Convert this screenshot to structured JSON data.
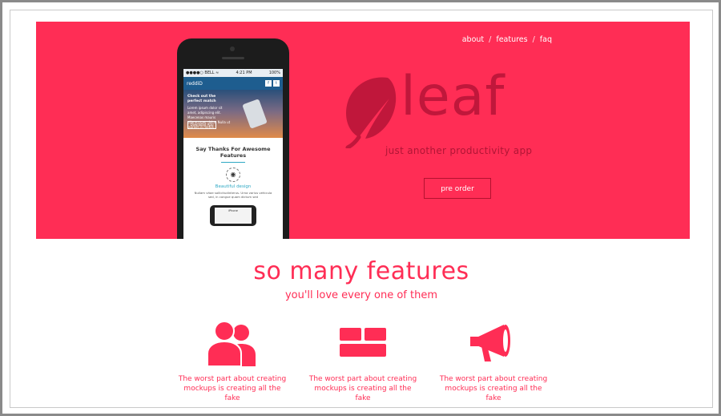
{
  "nav": {
    "items": [
      "about",
      "features",
      "faq"
    ],
    "separator": "/"
  },
  "hero": {
    "brand": "leaf",
    "tagline": "just another productivity app",
    "cta_label": "pre order",
    "background_color": "#ff2d55"
  },
  "phone_screen": {
    "status_carrier": "●●●●○ BELL ≈",
    "status_time": "4:21 PM",
    "status_battery": "100%",
    "app_name": "reddiD",
    "social": [
      "f",
      "t"
    ],
    "banner_title": "Check out the perfect match",
    "banner_body": "Lorem ipsum dolor sit amet, adipiscing elit. Maecenas mauris ullamcorper dolor. Nulla ut laoreet in metus.",
    "banner_button": "Download App",
    "section_heading": "Say Thanks For Awesome Features",
    "feature_title": "Beautiful design",
    "feature_desc": "Nullam vitae sollicitudinterus. Urna varius vehicula sed, in congue quam dictum sed",
    "mini_label": "iPhone"
  },
  "features_section": {
    "title": "so many features",
    "subtitle": "you'll love every one of them",
    "items": [
      {
        "icon": "users-icon",
        "text": "The worst part about creating mockups is creating all the fake"
      },
      {
        "icon": "layout-icon",
        "text": "The worst part about creating mockups is creating all the fake"
      },
      {
        "icon": "megaphone-icon",
        "text": "The worst part about creating mockups is creating all the fake"
      }
    ]
  },
  "colors": {
    "accent": "#ff2d55",
    "brand_dark": "#c0173b"
  }
}
